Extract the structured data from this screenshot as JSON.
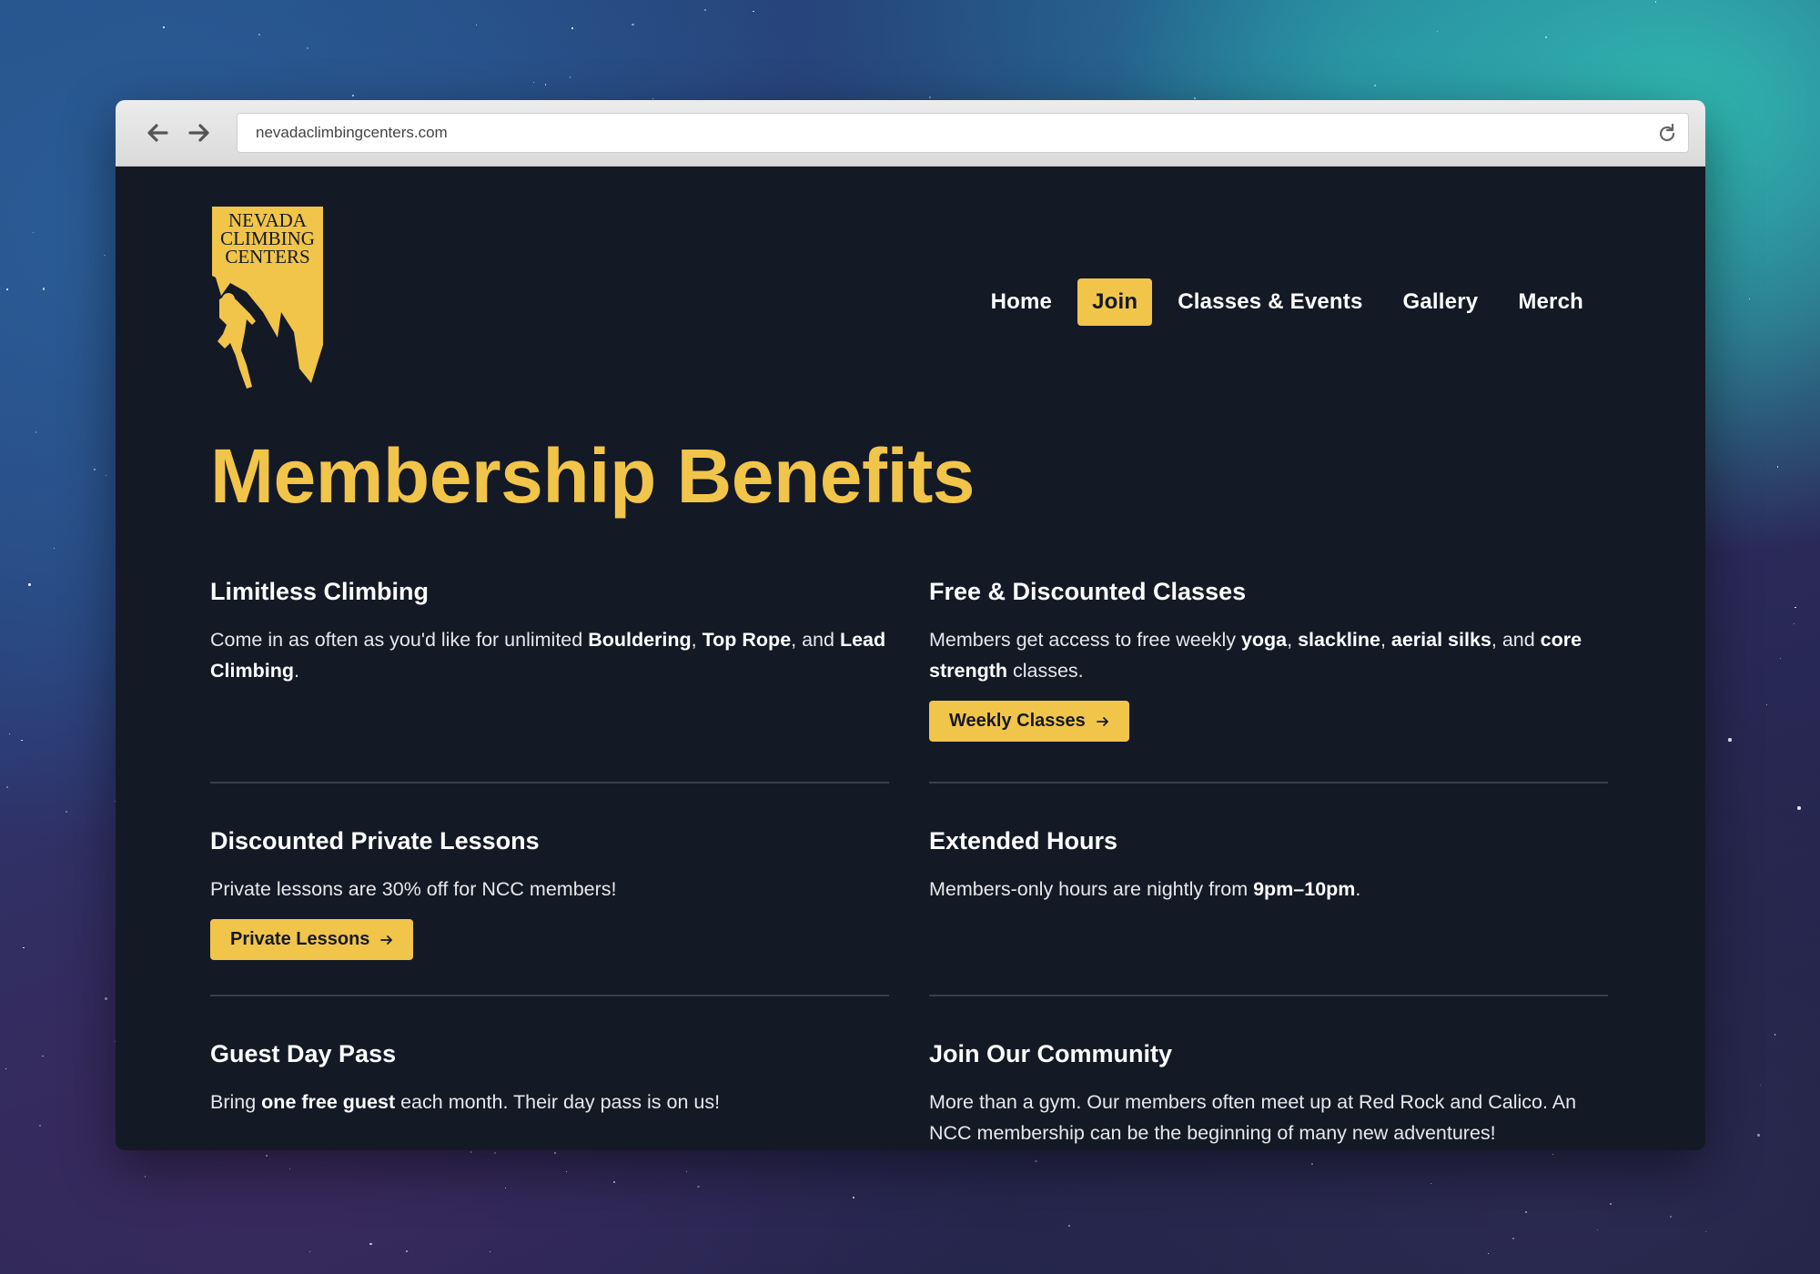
{
  "browser": {
    "url": "nevadaclimbingcenters.com",
    "back_icon": "arrow-left-icon",
    "forward_icon": "arrow-right-icon",
    "reload_icon": "reload-icon"
  },
  "logo": {
    "line1": "NEVADA",
    "line2": "CLIMBING",
    "line3": "CENTERS",
    "color": "#f1c44a"
  },
  "nav": {
    "items": [
      {
        "label": "Home",
        "active": false
      },
      {
        "label": "Join",
        "active": true
      },
      {
        "label": "Classes & Events",
        "active": false
      },
      {
        "label": "Gallery",
        "active": false
      },
      {
        "label": "Merch",
        "active": false
      }
    ]
  },
  "page_title": "Membership Benefits",
  "benefits": [
    {
      "heading": "Limitless Climbing",
      "text_parts": [
        "Come in as often as you'd like for unlimited ",
        "Bouldering",
        ", ",
        "Top Rope",
        ", and ",
        "Lead Climbing",
        "."
      ]
    },
    {
      "heading": "Free & Discounted Classes",
      "text_parts": [
        "Members get access to free weekly ",
        "yoga",
        ", ",
        "slackline",
        ", ",
        "aerial silks",
        ", and ",
        "core strength",
        " classes."
      ],
      "button": "Weekly Classes"
    },
    {
      "heading": "Discounted Private Lessons",
      "text": "Private lessons are 30% off for NCC members!",
      "button": "Private Lessons"
    },
    {
      "heading": "Extended Hours",
      "text_parts": [
        "Members-only hours are nightly from ",
        "9pm–10pm",
        "."
      ]
    },
    {
      "heading": "Guest Day Pass",
      "text_parts": [
        "Bring ",
        "one free guest",
        " each month. Their day pass is on us!"
      ]
    },
    {
      "heading": "Join Our Community",
      "text": "More than a gym. Our members often meet up at Red Rock and Calico. An NCC membership can be the beginning of many new adventures!"
    }
  ],
  "colors": {
    "accent": "#f1c44a",
    "page_background": "#141926",
    "divider": "#3a3f4c"
  }
}
